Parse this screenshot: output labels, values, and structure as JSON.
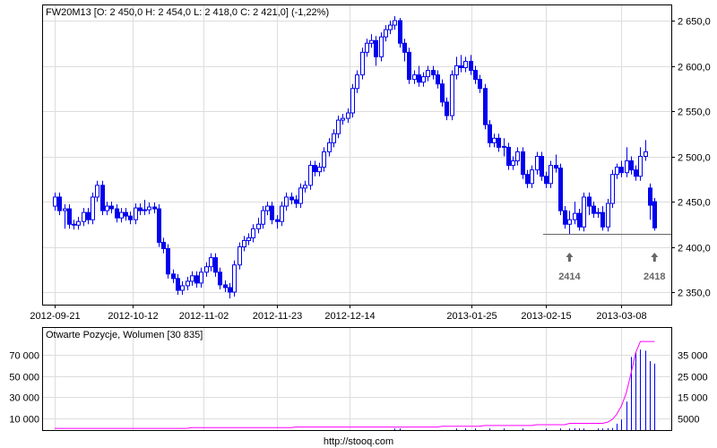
{
  "chart_data": [
    {
      "type": "candlestick",
      "title": "FW20M13 [O: 2 450,0  H: 2 454,0  L: 2 418,0  C: 2 421,0] (-1,22%)",
      "ylim": [
        2335,
        2668
      ],
      "y_ticks": [
        {
          "v": 2650,
          "label": "2 650,0"
        },
        {
          "v": 2600,
          "label": "2 600,0"
        },
        {
          "v": 2550,
          "label": "2 550,0"
        },
        {
          "v": 2500,
          "label": "2 500,0"
        },
        {
          "v": 2450,
          "label": "2 450,0"
        },
        {
          "v": 2400,
          "label": "2 400,0"
        },
        {
          "v": 2350,
          "label": "2 350,0"
        }
      ],
      "x_ticks": [
        {
          "i": 0,
          "label": "2012-09-21"
        },
        {
          "i": 16.5,
          "label": "2012-10-12"
        },
        {
          "i": 31.5,
          "label": "2012-11-02"
        },
        {
          "i": 47,
          "label": "2012-11-23"
        },
        {
          "i": 62.5,
          "label": "2012-12-14"
        },
        {
          "i": 88.3,
          "label": "2013-01-25"
        },
        {
          "i": 104,
          "label": "2013-02-15"
        },
        {
          "i": 120,
          "label": "2013-03-08"
        }
      ],
      "ohlc": [
        [
          2445,
          2460,
          2440,
          2455
        ],
        [
          2455,
          2460,
          2435,
          2440
        ],
        [
          2440,
          2447,
          2420,
          2442
        ],
        [
          2442,
          2447,
          2420,
          2425
        ],
        [
          2425,
          2430,
          2419,
          2424
        ],
        [
          2424,
          2433,
          2419,
          2428
        ],
        [
          2428,
          2443,
          2423,
          2438
        ],
        [
          2438,
          2443,
          2425,
          2430
        ],
        [
          2430,
          2460,
          2425,
          2455
        ],
        [
          2455,
          2473,
          2450,
          2468
        ],
        [
          2468,
          2473,
          2435,
          2440
        ],
        [
          2440,
          2450,
          2435,
          2445
        ],
        [
          2445,
          2450,
          2437,
          2442
        ],
        [
          2442,
          2447,
          2427,
          2432
        ],
        [
          2432,
          2443,
          2427,
          2438
        ],
        [
          2438,
          2443,
          2429,
          2434
        ],
        [
          2434,
          2439,
          2425,
          2430
        ],
        [
          2430,
          2448,
          2425,
          2443
        ],
        [
          2443,
          2448,
          2435,
          2440
        ],
        [
          2440,
          2452,
          2435,
          2441
        ],
        [
          2441,
          2449,
          2436,
          2444
        ],
        [
          2444,
          2449,
          2437,
          2442
        ],
        [
          2442,
          2447,
          2400,
          2405
        ],
        [
          2405,
          2410,
          2393,
          2398
        ],
        [
          2398,
          2403,
          2365,
          2370
        ],
        [
          2370,
          2375,
          2360,
          2365
        ],
        [
          2365,
          2370,
          2347,
          2352
        ],
        [
          2352,
          2362,
          2347,
          2357
        ],
        [
          2357,
          2367,
          2352,
          2362
        ],
        [
          2362,
          2373,
          2357,
          2368
        ],
        [
          2368,
          2373,
          2355,
          2360
        ],
        [
          2360,
          2377,
          2355,
          2372
        ],
        [
          2372,
          2383,
          2367,
          2378
        ],
        [
          2378,
          2393,
          2373,
          2388
        ],
        [
          2388,
          2393,
          2367,
          2372
        ],
        [
          2372,
          2377,
          2353,
          2358
        ],
        [
          2358,
          2363,
          2350,
          2355
        ],
        [
          2355,
          2360,
          2343,
          2350
        ],
        [
          2350,
          2385,
          2345,
          2380
        ],
        [
          2380,
          2405,
          2375,
          2400
        ],
        [
          2400,
          2412,
          2395,
          2407
        ],
        [
          2407,
          2415,
          2402,
          2410
        ],
        [
          2410,
          2425,
          2405,
          2420
        ],
        [
          2420,
          2432,
          2415,
          2425
        ],
        [
          2425,
          2445,
          2420,
          2440
        ],
        [
          2440,
          2450,
          2435,
          2445
        ],
        [
          2445,
          2450,
          2425,
          2430
        ],
        [
          2430,
          2435,
          2420,
          2428
        ],
        [
          2428,
          2450,
          2423,
          2445
        ],
        [
          2445,
          2460,
          2440,
          2455
        ],
        [
          2455,
          2460,
          2447,
          2452
        ],
        [
          2452,
          2457,
          2443,
          2448
        ],
        [
          2448,
          2470,
          2443,
          2465
        ],
        [
          2465,
          2473,
          2460,
          2468
        ],
        [
          2468,
          2495,
          2463,
          2490
        ],
        [
          2490,
          2495,
          2478,
          2483
        ],
        [
          2483,
          2493,
          2478,
          2488
        ],
        [
          2488,
          2510,
          2483,
          2505
        ],
        [
          2505,
          2520,
          2500,
          2515
        ],
        [
          2515,
          2530,
          2510,
          2525
        ],
        [
          2525,
          2545,
          2520,
          2540
        ],
        [
          2540,
          2547,
          2535,
          2542
        ],
        [
          2542,
          2553,
          2537,
          2548
        ],
        [
          2548,
          2580,
          2543,
          2575
        ],
        [
          2575,
          2595,
          2570,
          2590
        ],
        [
          2590,
          2620,
          2585,
          2615
        ],
        [
          2615,
          2630,
          2610,
          2625
        ],
        [
          2625,
          2635,
          2620,
          2628
        ],
        [
          2628,
          2633,
          2600,
          2610
        ],
        [
          2610,
          2637,
          2605,
          2632
        ],
        [
          2632,
          2645,
          2627,
          2640
        ],
        [
          2640,
          2650,
          2635,
          2645
        ],
        [
          2645,
          2655,
          2640,
          2650
        ],
        [
          2650,
          2653,
          2620,
          2625
        ],
        [
          2625,
          2630,
          2605,
          2615
        ],
        [
          2615,
          2620,
          2580,
          2585
        ],
        [
          2585,
          2595,
          2580,
          2590
        ],
        [
          2590,
          2600,
          2577,
          2582
        ],
        [
          2582,
          2593,
          2577,
          2588
        ],
        [
          2588,
          2600,
          2583,
          2595
        ],
        [
          2595,
          2600,
          2585,
          2590
        ],
        [
          2590,
          2595,
          2575,
          2580
        ],
        [
          2580,
          2585,
          2555,
          2560
        ],
        [
          2560,
          2565,
          2540,
          2545
        ],
        [
          2545,
          2595,
          2540,
          2590
        ],
        [
          2590,
          2610,
          2585,
          2600
        ],
        [
          2600,
          2612,
          2593,
          2598
        ],
        [
          2598,
          2610,
          2593,
          2605
        ],
        [
          2605,
          2612,
          2590,
          2595
        ],
        [
          2595,
          2600,
          2580,
          2585
        ],
        [
          2585,
          2590,
          2570,
          2575
        ],
        [
          2575,
          2580,
          2530,
          2535
        ],
        [
          2535,
          2540,
          2510,
          2515
        ],
        [
          2515,
          2525,
          2510,
          2520
        ],
        [
          2520,
          2525,
          2505,
          2510
        ],
        [
          2510,
          2520,
          2500,
          2511
        ],
        [
          2510,
          2515,
          2485,
          2490
        ],
        [
          2490,
          2500,
          2485,
          2495
        ],
        [
          2495,
          2510,
          2490,
          2505
        ],
        [
          2505,
          2510,
          2475,
          2480
        ],
        [
          2480,
          2485,
          2465,
          2470
        ],
        [
          2470,
          2490,
          2465,
          2485
        ],
        [
          2485,
          2505,
          2480,
          2500
        ],
        [
          2500,
          2505,
          2473,
          2478
        ],
        [
          2478,
          2483,
          2465,
          2470
        ],
        [
          2470,
          2495,
          2465,
          2490
        ],
        [
          2490,
          2502,
          2482,
          2487
        ],
        [
          2487,
          2492,
          2435,
          2440
        ],
        [
          2440,
          2445,
          2420,
          2425
        ],
        [
          2425,
          2440,
          2414,
          2430
        ],
        [
          2430,
          2450,
          2425,
          2437
        ],
        [
          2437,
          2442,
          2418,
          2422
        ],
        [
          2422,
          2460,
          2417,
          2455
        ],
        [
          2455,
          2460,
          2435,
          2445
        ],
        [
          2445,
          2450,
          2432,
          2437
        ],
        [
          2437,
          2443,
          2432,
          2438
        ],
        [
          2438,
          2445,
          2418,
          2422
        ],
        [
          2422,
          2453,
          2417,
          2448
        ],
        [
          2448,
          2485,
          2443,
          2480
        ],
        [
          2480,
          2492,
          2475,
          2488
        ],
        [
          2488,
          2495,
          2477,
          2482
        ],
        [
          2482,
          2510,
          2477,
          2495
        ],
        [
          2495,
          2500,
          2480,
          2485
        ],
        [
          2485,
          2490,
          2473,
          2478
        ],
        [
          2478,
          2510,
          2473,
          2500
        ],
        [
          2500,
          2518,
          2495,
          2505
        ],
        [
          2465,
          2470,
          2430,
          2446
        ],
        [
          2450,
          2454,
          2418,
          2421
        ]
      ],
      "annotations": [
        {
          "i": 109,
          "value": 2414,
          "label": "2414"
        },
        {
          "i": 127,
          "value": 2418,
          "label": "2418"
        }
      ],
      "support_line": 2414,
      "colors": {
        "candle": "#0000ee",
        "grid": "#dddddd",
        "annotation": "#666666"
      }
    },
    {
      "type": "bar+line",
      "title": "Otwarte Pozycje, Wolumen [30 835]",
      "left_ticks": [
        {
          "v": 70000,
          "label": "70 000"
        },
        {
          "v": 50000,
          "label": "50 000"
        },
        {
          "v": 30000,
          "label": "30 000"
        },
        {
          "v": 10000,
          "label": "10 000"
        }
      ],
      "right_ticks": [
        {
          "v": 35000,
          "label": "35 000"
        },
        {
          "v": 25000,
          "label": "25 000"
        },
        {
          "v": 15000,
          "label": "15 000"
        },
        {
          "v": 5000,
          "label": "5000"
        }
      ],
      "open_interest_steps": [
        [
          0,
          800
        ],
        [
          29,
          1500
        ],
        [
          51,
          2000
        ],
        [
          82,
          2800
        ],
        [
          91,
          3500
        ],
        [
          102,
          4200
        ],
        [
          109,
          5500
        ]
      ],
      "open_interest_ramp": {
        "117": 6500,
        "118": 9000,
        "119": 14000,
        "120": 22000,
        "121": 34000,
        "122": 52000,
        "123": 72000,
        "124": 82700,
        "125": 82700,
        "126": 82700,
        "127": 82700
      },
      "volume": {
        "72": 300,
        "73": 300,
        "85": 300,
        "87": 300,
        "89": 300,
        "92": 300,
        "95": 300,
        "99": 300,
        "104": 300,
        "107": 300,
        "109": 300,
        "110": 400,
        "111": 300,
        "112": 300,
        "115": 300,
        "116": 300,
        "117": 400,
        "118": 600,
        "119": 2600,
        "120": 4600,
        "121": 13000,
        "122": 34000,
        "123": 36000,
        "124": 37500,
        "125": 37000,
        "126": 32000,
        "127": 30835
      },
      "colors": {
        "open_interest": "#ff00ff",
        "volume": "#0000ee"
      }
    }
  ],
  "footer": "http://stooq.com"
}
